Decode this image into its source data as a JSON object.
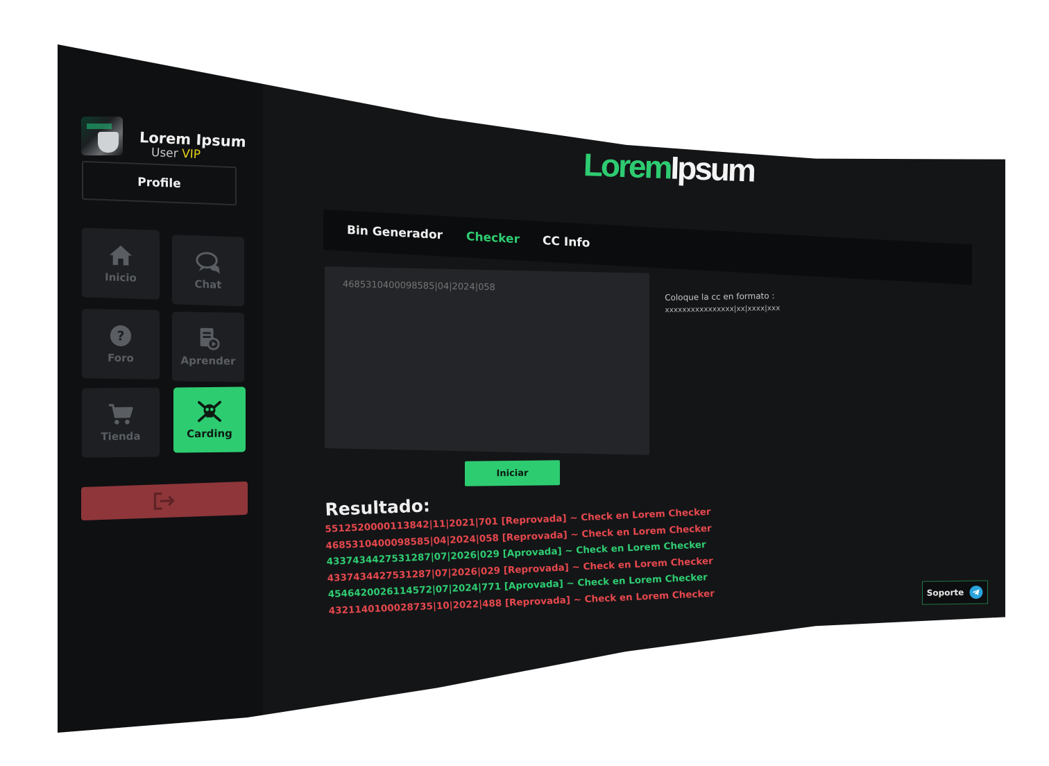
{
  "sidebar": {
    "user_name": "Lorem Ipsum",
    "user_role_prefix": "User",
    "user_role_badge": "VIP",
    "profile_label": "Profile",
    "nav": [
      {
        "label": "Inicio",
        "icon": "home-icon"
      },
      {
        "label": "Chat",
        "icon": "chat-icon"
      },
      {
        "label": "Foro",
        "icon": "help-icon"
      },
      {
        "label": "Aprender",
        "icon": "learn-icon"
      },
      {
        "label": "Tienda",
        "icon": "cart-icon"
      },
      {
        "label": "Carding",
        "icon": "skull-crossbones-icon",
        "active": true
      }
    ],
    "logout_icon": "logout-icon"
  },
  "header": {
    "logo_part1": "Lorem",
    "logo_part2": "Ipsum"
  },
  "tabs": [
    {
      "label": "Bin Generador"
    },
    {
      "label": "Checker",
      "active": true
    },
    {
      "label": "CC Info"
    }
  ],
  "checker": {
    "input_placeholder": "4685310400098585|04|2024|058",
    "hint_line1": "Coloque la cc en formato :",
    "hint_line2": "xxxxxxxxxxxxxxxx|xx|xxxx|xxx",
    "start_label": "Iniciar"
  },
  "results": {
    "title": "Resultado:",
    "rows": [
      {
        "text": "5512520000113842|11|2021|701 [Reprovada] ~ Check en Lorem Checker",
        "status": "bad"
      },
      {
        "text": "4685310400098585|04|2024|058 [Reprovada] ~ Check en Lorem Checker",
        "status": "bad"
      },
      {
        "text": "4337434427531287|07|2026|029 [Aprovada] ~ Check en Lorem Checker",
        "status": "good"
      },
      {
        "text": "4337434427531287|07|2026|029 [Reprovada] ~ Check en Lorem Checker",
        "status": "bad"
      },
      {
        "text": "4546420026114572|07|2024|771 [Aprovada] ~ Check en Lorem Checker",
        "status": "good"
      },
      {
        "text": "4321140100028735|10|2022|488 [Reprovada] ~ Check en Lorem Checker",
        "status": "bad"
      }
    ]
  },
  "support": {
    "label": "Soporte",
    "icon": "telegram-icon"
  },
  "colors": {
    "accent": "#2ecc71",
    "error": "#e5484d",
    "vip": "#e5d21a",
    "logout": "#8f363a"
  }
}
